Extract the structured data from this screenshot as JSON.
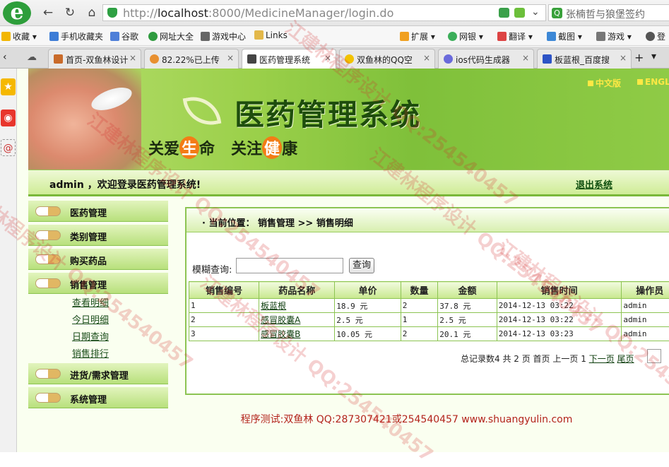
{
  "browser": {
    "logo_text": "e",
    "url_host": "localhost",
    "url_rest": ":8000/MedicineManager/login.do",
    "url_scheme": "http://",
    "search_text": "张楠哲与狼堡签约",
    "bookmarks": [
      "收藏",
      "手机收藏夹",
      "谷歌",
      "网址大全",
      "游戏中心",
      "Links",
      "扩展",
      "网银",
      "翻译",
      "截图",
      "游戏",
      "登"
    ],
    "tabs": [
      {
        "label": "首页-双鱼林设计",
        "active": false
      },
      {
        "label": "82.22%已上传",
        "active": false
      },
      {
        "label": "医药管理系统",
        "active": true
      },
      {
        "label": "双鱼林的QQ空",
        "active": false
      },
      {
        "label": "ios代码生成器",
        "active": false
      },
      {
        "label": "板蓝根_百度搜",
        "active": false
      }
    ]
  },
  "banner": {
    "title": "医药管理系统",
    "slogan_pre1": "关爱",
    "slogan_hl1": "生",
    "slogan_post1": "命",
    "slogan_pre2": "关注",
    "slogan_hl2": "健",
    "slogan_post2": "康",
    "lang_cn": "中文版",
    "lang_en": "ENGL"
  },
  "welcome": {
    "text": "admin ，欢迎登录医药管理系统!",
    "logout": "退出系统"
  },
  "menu": {
    "groups": [
      {
        "label": "医药管理"
      },
      {
        "label": "类别管理"
      },
      {
        "label": "购买药品"
      },
      {
        "label": "销售管理"
      },
      {
        "label": "进货/需求管理"
      },
      {
        "label": "系统管理"
      }
    ],
    "sales_sub": [
      "查看明细",
      "今日明细",
      "日期查询",
      "销售排行"
    ]
  },
  "content": {
    "breadcrumb": "· 当前位置：  销售管理  >>  销售明细",
    "search_label": "模糊查询:",
    "search_value": "",
    "search_button": "查询",
    "columns": [
      "销售编号",
      "药品名称",
      "单价",
      "数量",
      "金额",
      "销售时间",
      "操作员"
    ],
    "rows": [
      {
        "id": "1",
        "name": "板蓝根",
        "price": "18.9 元",
        "qty": "2",
        "amount": "37.8 元",
        "time": "2014-12-13 03:22",
        "op": "admin"
      },
      {
        "id": "2",
        "name": "感冒胶囊A",
        "price": "2.5 元",
        "qty": "1",
        "amount": "2.5 元",
        "time": "2014-12-13 03:22",
        "op": "admin"
      },
      {
        "id": "3",
        "name": "感冒胶囊B",
        "price": "10.05 元",
        "qty": "2",
        "amount": "20.1 元",
        "time": "2014-12-13 03:23",
        "op": "admin"
      }
    ],
    "pager": {
      "summary": "总记录数4 共 2 页",
      "first": "首页",
      "prev": "上一页",
      "current": "1",
      "next": "下一页",
      "last": "尾页"
    }
  },
  "footer": "程序测试:双鱼林 QQ:287307421或254540457 www.shuangyulin.com",
  "watermark": "江建林程序设计 QQ:254540457"
}
